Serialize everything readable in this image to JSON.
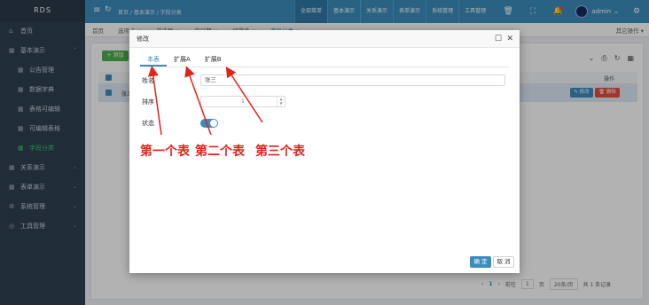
{
  "sidebar": {
    "logo": "RDS",
    "items": [
      {
        "label": "首页",
        "icon": "home-icon",
        "glyph": "⌂"
      },
      {
        "label": "基本演示",
        "icon": "grid-icon",
        "glyph": "▦",
        "chev": "⌃"
      },
      {
        "label": "公告管理",
        "icon": "grid-icon",
        "glyph": "▦",
        "sub": true
      },
      {
        "label": "数据字典",
        "icon": "grid-icon",
        "glyph": "▦",
        "sub": true
      },
      {
        "label": "表格可编辑",
        "icon": "grid-icon",
        "glyph": "▦",
        "sub": true
      },
      {
        "label": "可编辑表格",
        "icon": "grid-icon",
        "glyph": "▦",
        "sub": true
      },
      {
        "label": "字段分类",
        "icon": "grid-icon",
        "glyph": "▦",
        "sub": true,
        "active": true
      },
      {
        "label": "关系演示",
        "icon": "grid-icon",
        "glyph": "▦",
        "chev": "⌄"
      },
      {
        "label": "表单演示",
        "icon": "grid-icon",
        "glyph": "▦",
        "chev": "⌄"
      },
      {
        "label": "系统管理",
        "icon": "gear-icon",
        "glyph": "⚙",
        "chev": "⌄"
      },
      {
        "label": "工具管理",
        "icon": "globe-icon",
        "glyph": "◎",
        "chev": "⌄"
      }
    ]
  },
  "topbar": {
    "breadcrumb": "首页 / 基本演示 / 字段分类",
    "menu": [
      "全部菜单",
      "基本演示",
      "关系演示",
      "表单演示",
      "系统管理",
      "工具管理"
    ],
    "active_menu": 0,
    "user": "admin"
  },
  "tabs": {
    "items": [
      "首页",
      "选项卡 ×",
      "单选框 ×",
      "单日期 ×",
      "编辑表 ×",
      "字段分类 ×"
    ],
    "active": 5,
    "more": "其它操作 ▾"
  },
  "content": {
    "add_button": "+ 添加",
    "op_header": "操作",
    "row_text": "张三",
    "edit_button": "✎ 修改",
    "delete_button": "🗑 删除",
    "pager": {
      "prev": "‹",
      "page": "1",
      "next": "›",
      "goto_label": "前往",
      "goto_value": "1",
      "page_unit": "页",
      "page_size": "20条/页",
      "total": "共 1 条记录"
    }
  },
  "modal": {
    "title": "修改",
    "tabs": [
      "本表",
      "扩展A",
      "扩展B"
    ],
    "active_tab": 0,
    "fields": {
      "name_label": "姓名",
      "name_value": "张三",
      "sort_label": "排序",
      "sort_value": "1",
      "status_label": "状态",
      "status_on": true
    },
    "ok_button": "确 定",
    "cancel_button": "取 消"
  },
  "annotations": [
    "第一个表",
    "第二个表",
    "第三个表"
  ],
  "colors": {
    "sidebar_bg": "#2f4050",
    "topbar_bg": "#3c8dbc",
    "accent": "#3c8dbc",
    "annotation": "#e2231a",
    "active_green": "#2ecc71"
  }
}
